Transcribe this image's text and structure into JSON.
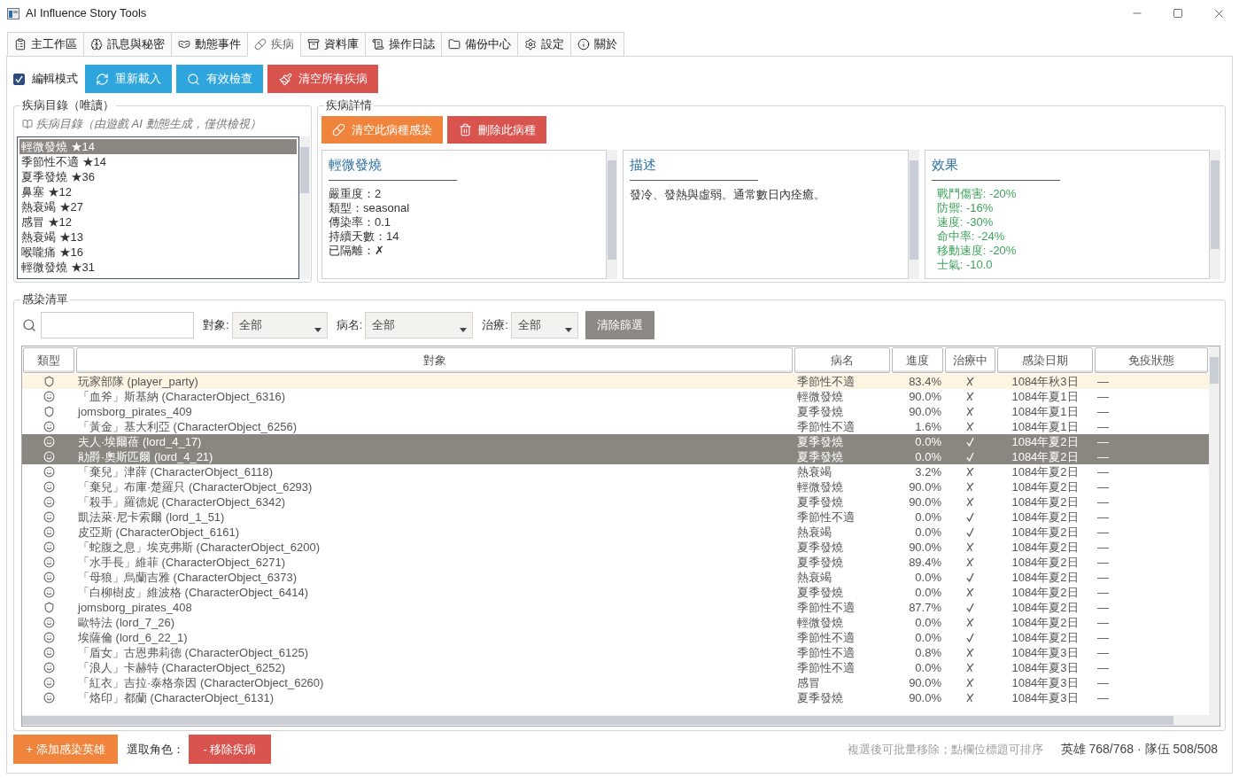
{
  "window": {
    "title": "AI Influence Story Tools"
  },
  "tabs": [
    {
      "label": "主工作區",
      "selected": false
    },
    {
      "label": "訊息與秘密",
      "selected": false
    },
    {
      "label": "動態事件",
      "selected": false
    },
    {
      "label": "疾病",
      "selected": true
    },
    {
      "label": "資料庫",
      "selected": false
    },
    {
      "label": "操作日誌",
      "selected": false
    },
    {
      "label": "備份中心",
      "selected": false
    },
    {
      "label": "設定",
      "selected": false
    },
    {
      "label": "關於",
      "selected": false
    }
  ],
  "toolbar": {
    "edit_mode": {
      "label": "編輯模式",
      "checked": true
    },
    "buttons": [
      {
        "label": "重新載入",
        "kind": "info"
      },
      {
        "label": "有效檢查",
        "kind": "info"
      },
      {
        "label": "清空所有疾病",
        "kind": "danger"
      }
    ]
  },
  "catalog": {
    "title": "疾病目錄（唯讀）",
    "hint": "疾病目錄（由遊戲 AI 動態生成，僅供檢視）",
    "items": [
      {
        "label": "輕微發燒 ★14",
        "selected": true
      },
      {
        "label": "季節性不適 ★14",
        "selected": false
      },
      {
        "label": "夏季發燒 ★36",
        "selected": false
      },
      {
        "label": "鼻塞 ★12",
        "selected": false
      },
      {
        "label": "熱衰竭 ★27",
        "selected": false
      },
      {
        "label": "感冒 ★12",
        "selected": false
      },
      {
        "label": "熱衰竭 ★13",
        "selected": false
      },
      {
        "label": "喉嚨痛 ★16",
        "selected": false
      },
      {
        "label": "輕微發燒 ★31",
        "selected": false
      }
    ]
  },
  "details": {
    "title": "疾病詳情",
    "buttons": [
      {
        "label": "清空此病種感染",
        "kind": "warning"
      },
      {
        "label": "刪除此病種",
        "kind": "danger"
      }
    ],
    "info": {
      "heading": "輕微發燒",
      "lines": [
        "嚴重度：2",
        "類型：seasonal",
        "傳染率：0.1",
        "持續天數：14",
        "已隔離：✗"
      ]
    },
    "description": {
      "heading": "描述",
      "text": "發冷、發熱與虛弱。通常數日內痊癒。"
    },
    "effects": {
      "heading": "效果",
      "lines": [
        "戰鬥傷害: -20%",
        "防禦: -16%",
        "速度: -30%",
        "命中率: -24%",
        "移動速度: -20%",
        "士氣: -10.0"
      ]
    }
  },
  "infections": {
    "title": "感染清單",
    "filters": [
      {
        "label": "對象:",
        "value": "全部"
      },
      {
        "label": "病名:",
        "value": "全部"
      },
      {
        "label": "治療:",
        "value": "全部"
      }
    ],
    "clear_button": {
      "label": "清除篩選",
      "kind": "neutral"
    },
    "columns": [
      "類型",
      "對象",
      "病名",
      "進度",
      "治療中",
      "感染日期",
      "免疫狀態"
    ],
    "rows": [
      {
        "kind": "party",
        "target": "玩家部隊 (player_party)",
        "disease": "季節性不適",
        "progress": "83.4%",
        "treating": false,
        "date": "1084年秋3日",
        "immunity": "—",
        "selected": false,
        "highlighted": true
      },
      {
        "kind": "hero",
        "target": "「血斧」斯基納 (CharacterObject_6316)",
        "disease": "輕微發燒",
        "progress": "90.0%",
        "treating": false,
        "date": "1084年夏1日",
        "immunity": "—",
        "selected": false,
        "highlighted": false
      },
      {
        "kind": "party",
        "target": "jomsborg_pirates_409",
        "disease": "夏季發燒",
        "progress": "90.0%",
        "treating": false,
        "date": "1084年夏1日",
        "immunity": "—",
        "selected": false,
        "highlighted": false
      },
      {
        "kind": "hero",
        "target": "「黃金」基大利亞 (CharacterObject_6256)",
        "disease": "季節性不適",
        "progress": "1.6%",
        "treating": false,
        "date": "1084年夏1日",
        "immunity": "—",
        "selected": false,
        "highlighted": false
      },
      {
        "kind": "hero",
        "target": "夫人·埃爾蓓 (lord_4_17)",
        "disease": "夏季發燒",
        "progress": "0.0%",
        "treating": true,
        "date": "1084年夏2日",
        "immunity": "—",
        "selected": true,
        "highlighted": false
      },
      {
        "kind": "hero",
        "target": "勛爵·奧斯匹爾 (lord_4_21)",
        "disease": "夏季發燒",
        "progress": "0.0%",
        "treating": true,
        "date": "1084年夏2日",
        "immunity": "—",
        "selected": true,
        "highlighted": false
      },
      {
        "kind": "hero",
        "target": "「棄兒」津薛 (CharacterObject_6118)",
        "disease": "熱衰竭",
        "progress": "3.2%",
        "treating": false,
        "date": "1084年夏2日",
        "immunity": "—",
        "selected": false,
        "highlighted": false
      },
      {
        "kind": "hero",
        "target": "「棄兒」布庫·楚羅只 (CharacterObject_6293)",
        "disease": "輕微發燒",
        "progress": "90.0%",
        "treating": false,
        "date": "1084年夏2日",
        "immunity": "—",
        "selected": false,
        "highlighted": false
      },
      {
        "kind": "hero",
        "target": "「殺手」羅德妮 (CharacterObject_6342)",
        "disease": "夏季發燒",
        "progress": "90.0%",
        "treating": false,
        "date": "1084年夏2日",
        "immunity": "—",
        "selected": false,
        "highlighted": false
      },
      {
        "kind": "hero",
        "target": "凱法萊·尼卡索爾 (lord_1_51)",
        "disease": "季節性不適",
        "progress": "0.0%",
        "treating": true,
        "date": "1084年夏2日",
        "immunity": "—",
        "selected": false,
        "highlighted": false
      },
      {
        "kind": "hero",
        "target": "皮亞斯 (CharacterObject_6161)",
        "disease": "熱衰竭",
        "progress": "0.0%",
        "treating": true,
        "date": "1084年夏2日",
        "immunity": "—",
        "selected": false,
        "highlighted": false
      },
      {
        "kind": "hero",
        "target": "「蛇腹之息」埃克弗斯 (CharacterObject_6200)",
        "disease": "夏季發燒",
        "progress": "90.0%",
        "treating": false,
        "date": "1084年夏2日",
        "immunity": "—",
        "selected": false,
        "highlighted": false
      },
      {
        "kind": "hero",
        "target": "「水手長」維菲 (CharacterObject_6271)",
        "disease": "夏季發燒",
        "progress": "89.4%",
        "treating": false,
        "date": "1084年夏2日",
        "immunity": "—",
        "selected": false,
        "highlighted": false
      },
      {
        "kind": "hero",
        "target": "「母狼」烏蘭吉雅 (CharacterObject_6373)",
        "disease": "熱衰竭",
        "progress": "0.0%",
        "treating": true,
        "date": "1084年夏2日",
        "immunity": "—",
        "selected": false,
        "highlighted": false
      },
      {
        "kind": "hero",
        "target": "「白柳樹皮」維波格 (CharacterObject_6414)",
        "disease": "夏季發燒",
        "progress": "0.0%",
        "treating": false,
        "date": "1084年夏2日",
        "immunity": "—",
        "selected": false,
        "highlighted": false
      },
      {
        "kind": "party",
        "target": "jomsborg_pirates_408",
        "disease": "季節性不適",
        "progress": "87.7%",
        "treating": true,
        "date": "1084年夏2日",
        "immunity": "—",
        "selected": false,
        "highlighted": false
      },
      {
        "kind": "hero",
        "target": "歐特法 (lord_7_26)",
        "disease": "輕微發燒",
        "progress": "0.0%",
        "treating": false,
        "date": "1084年夏2日",
        "immunity": "—",
        "selected": false,
        "highlighted": false
      },
      {
        "kind": "hero",
        "target": "埃薩倫 (lord_6_22_1)",
        "disease": "季節性不適",
        "progress": "0.0%",
        "treating": true,
        "date": "1084年夏2日",
        "immunity": "—",
        "selected": false,
        "highlighted": false
      },
      {
        "kind": "hero",
        "target": "「盾女」古恩弗莉德 (CharacterObject_6125)",
        "disease": "季節性不適",
        "progress": "0.8%",
        "treating": false,
        "date": "1084年夏3日",
        "immunity": "—",
        "selected": false,
        "highlighted": false
      },
      {
        "kind": "hero",
        "target": "「浪人」卡赫特 (CharacterObject_6252)",
        "disease": "季節性不適",
        "progress": "0.0%",
        "treating": false,
        "date": "1084年夏3日",
        "immunity": "—",
        "selected": false,
        "highlighted": false
      },
      {
        "kind": "hero",
        "target": "「紅衣」吉拉·泰格奈因 (CharacterObject_6260)",
        "disease": "感冒",
        "progress": "90.0%",
        "treating": false,
        "date": "1084年夏3日",
        "immunity": "—",
        "selected": false,
        "highlighted": false
      },
      {
        "kind": "hero",
        "target": "「烙印」都蘭 (CharacterObject_6131)",
        "disease": "夏季發燒",
        "progress": "90.0%",
        "treating": false,
        "date": "1084年夏3日",
        "immunity": "—",
        "selected": false,
        "highlighted": false
      }
    ]
  },
  "footer": {
    "add_button": {
      "label": "+ 添加感染英雄",
      "kind": "warning"
    },
    "selection_label": "選取角色：",
    "remove_button": {
      "label": "- 移除疾病",
      "kind": "danger"
    },
    "hint": "複選後可批量移除；點欄位標題可排序",
    "counts": "英雄 768/768 · 隊伍 508/508"
  }
}
